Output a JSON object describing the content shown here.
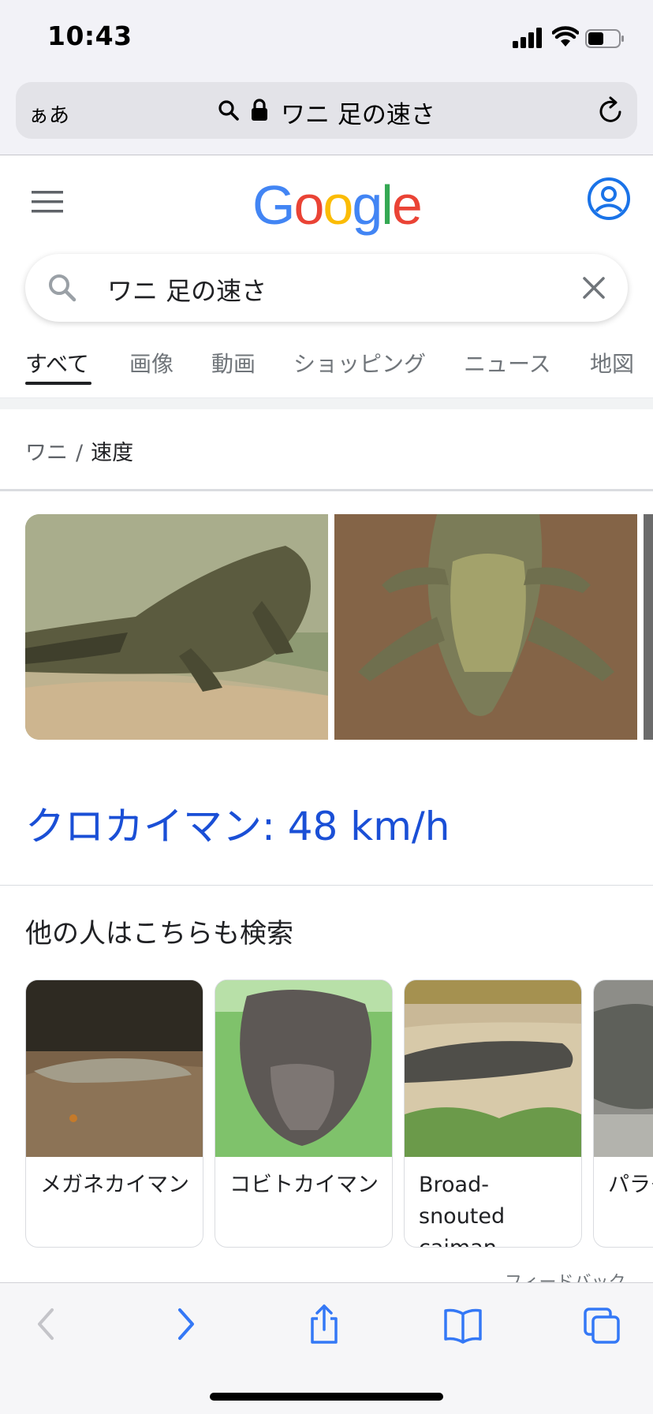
{
  "status_bar": {
    "time": "10:43"
  },
  "browser": {
    "text_size_label": "ぁあ",
    "url_text": "ワニ 足の速さ"
  },
  "google": {
    "logo_letters": [
      "G",
      "o",
      "o",
      "g",
      "l",
      "e"
    ],
    "logo_colors": [
      "#4285F4",
      "#EA4335",
      "#FBBC05",
      "#4285F4",
      "#34A853",
      "#EA4335"
    ],
    "search_query": "ワニ 足の速さ",
    "tabs": [
      "すべて",
      "画像",
      "動画",
      "ショッピング",
      "ニュース",
      "地図"
    ],
    "breadcrumb": {
      "parent": "ワニ",
      "separator": "/",
      "current": "速度"
    },
    "answer": "クロカイマン: 48 km/h",
    "people_also_search_title": "他の人はこちらも検索",
    "related": [
      {
        "label": "メガネカイマン"
      },
      {
        "label": "コビトカイマン"
      },
      {
        "label": "Broad-snouted caiman"
      },
      {
        "label": "パラグアイカイマン"
      }
    ],
    "feedback_label": "フィードバック"
  },
  "icons": {
    "menu": "hamburger-menu-icon",
    "account": "account-circle-icon",
    "search": "search-icon",
    "clear": "close-icon",
    "lock": "lock-icon",
    "reload": "reload-icon",
    "back": "chevron-left-icon",
    "forward": "chevron-right-icon",
    "share": "share-icon",
    "bookmarks": "book-icon",
    "tabs": "tabs-icon"
  },
  "colors": {
    "link_blue": "#1a4fd6",
    "ios_blue": "#3478f6"
  }
}
